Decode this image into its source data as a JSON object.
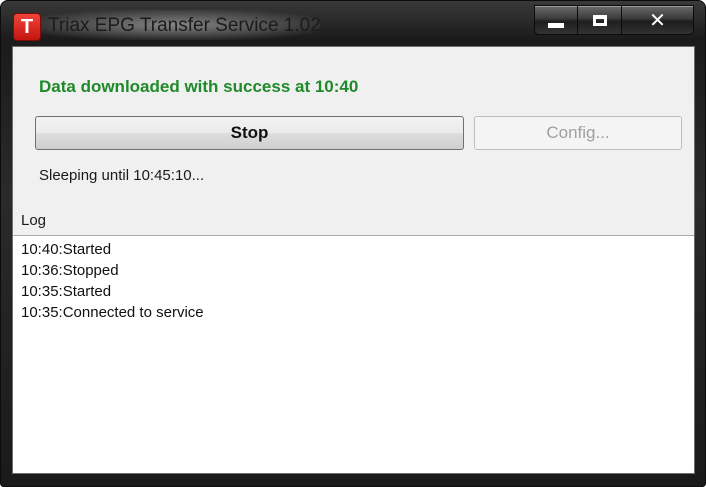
{
  "window": {
    "title": "Triax EPG Transfer Service 1.02",
    "icon_letter": "T",
    "caption": {
      "minimize": "minimize-icon",
      "maximize": "maximize-icon",
      "close_glyph": "✕"
    }
  },
  "status": {
    "message": "Data downloaded with success at 10:40",
    "color": "#1f8a2a"
  },
  "buttons": {
    "stop_label": "Stop",
    "config_label": "Config..."
  },
  "sleep_text": "Sleeping until 10:45:10...",
  "log": {
    "label": "Log",
    "entries": [
      "10:40:Started",
      "10:36:Stopped",
      "10:35:Started",
      "10:35:Connected to service"
    ]
  },
  "colors": {
    "app_icon": "#d9221a",
    "status_text": "#1f8a2a",
    "disabled_text": "#a0a0a0"
  }
}
